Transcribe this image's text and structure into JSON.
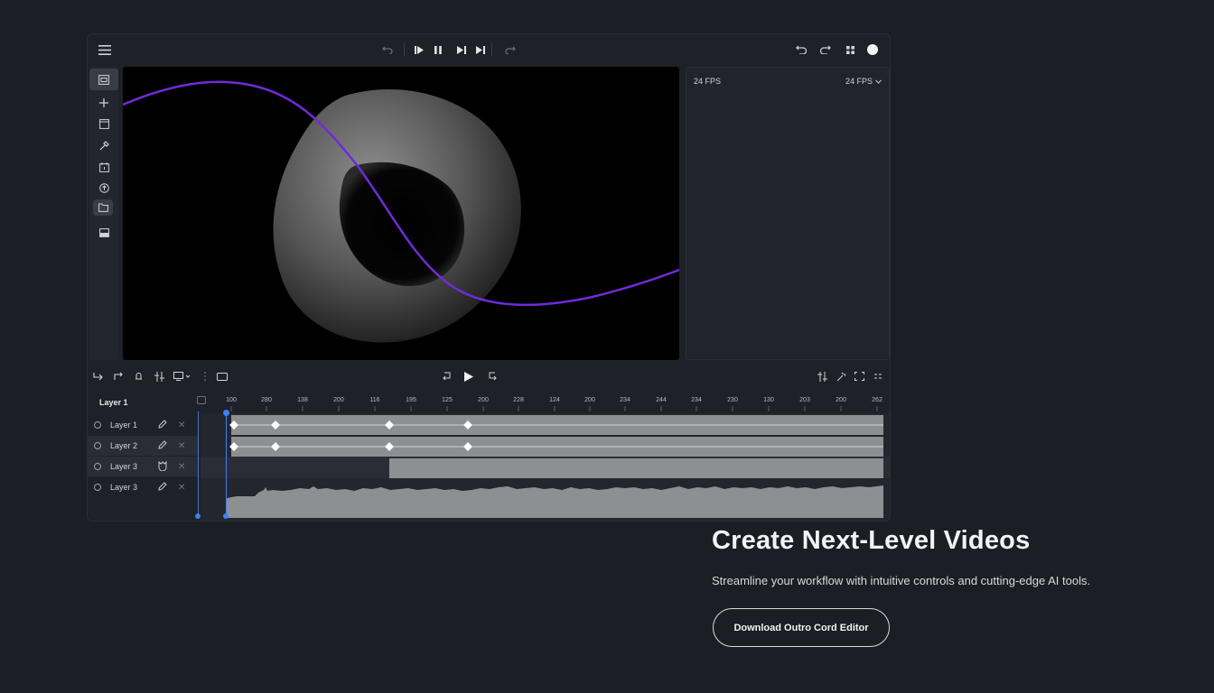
{
  "editor": {
    "side_panel": {
      "fps_label": "24 FPS",
      "fps_value": "24 FPS"
    },
    "layers_title": "Layer 1",
    "layers": [
      {
        "name": "Layer 1",
        "selected": false
      },
      {
        "name": "Layer 2",
        "selected": true
      },
      {
        "name": "Layer 3",
        "selected": true
      },
      {
        "name": "Layer 3",
        "selected": false
      }
    ],
    "ruler_labels": [
      "100",
      "280",
      "138",
      "200",
      "116",
      "195",
      "125",
      "200",
      "228",
      "124",
      "200",
      "234",
      "244",
      "234",
      "230",
      "130",
      "203",
      "200",
      "262"
    ],
    "icons": {
      "menu": "menu-icon",
      "undo": "undo-icon",
      "redo": "redo-icon",
      "play": "play-icon",
      "pause": "pause-icon",
      "skip": "skip-forward-icon",
      "grid": "grid-icon",
      "record": "record-dot-icon"
    },
    "colors": {
      "accent_curve": "#6f2bd9",
      "playhead": "#3b82f6",
      "track": "#8e8f93"
    }
  },
  "hero": {
    "title": "Create Next-Level Videos",
    "subtitle": "Streamline your workflow with intuitive controls and cutting-edge AI tools.",
    "cta": "Download Outro Cord Editor"
  }
}
